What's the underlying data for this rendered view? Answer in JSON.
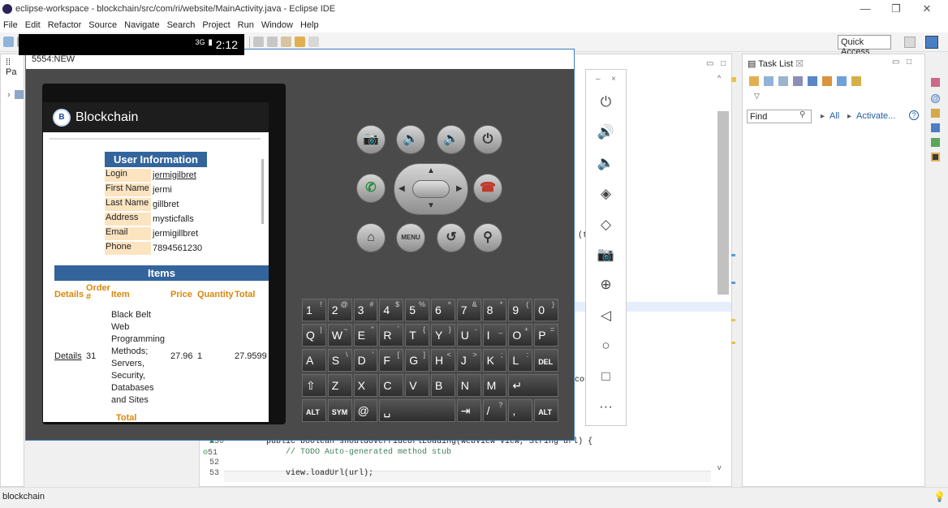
{
  "window": {
    "title": "eclipse-workspace - blockchain/src/com/ri/website/MainActivity.java - Eclipse IDE"
  },
  "menu": [
    "File",
    "Edit",
    "Refactor",
    "Source",
    "Navigate",
    "Search",
    "Project",
    "Run",
    "Window",
    "Help"
  ],
  "toolbar": {
    "quick_access": "Quick Access"
  },
  "left_panel": {
    "tab": "Pa"
  },
  "task_list": {
    "tab": "Task List",
    "find": "Find",
    "all": "All",
    "activate": "Activate..."
  },
  "editor": {
    "lines": [
      {
        "num": "50",
        "code": "public boolean shouldOverrideUrlLoading(WebView view, String url) {"
      },
      {
        "num": "51",
        "code": "// TODO Auto-generated method stub"
      },
      {
        "num": "52",
        "code": ""
      },
      {
        "num": "53",
        "code": "view.loadUrl(url);"
      }
    ],
    "fragment_t": "(t",
    "fragment_con": "con"
  },
  "emulator": {
    "title": "5554:NEW",
    "status_time": "2:12",
    "status_signal": "3G",
    "app_logo": "B",
    "app_name": "Blockchain",
    "user_info": {
      "header": "User Information",
      "rows": [
        {
          "label": "Login",
          "value": "jermigilbret"
        },
        {
          "label": "First Name",
          "value": "jermi"
        },
        {
          "label": "Last Name",
          "value": "gillbret"
        },
        {
          "label": "Address",
          "value": "mysticfalls"
        },
        {
          "label": "Email",
          "value": "jermigillbret"
        },
        {
          "label": "Phone",
          "value": "7894561230"
        }
      ]
    },
    "items": {
      "header": "Items",
      "columns": {
        "details": "Details",
        "order": "Order #",
        "item": "Item",
        "price": "Price",
        "quantity": "Quantity",
        "total": "Total"
      },
      "row": {
        "details": "Details",
        "order": "31",
        "item": "Black Belt Web Programming Methods; Servers, Security, Databases and Sites",
        "price": "27.96",
        "quantity": "1",
        "total": "27.9599"
      },
      "footer": "Total"
    },
    "hw_buttons": {
      "menu": "MENU"
    },
    "keyboard": {
      "row1": [
        [
          "1",
          "!"
        ],
        [
          "2",
          "@"
        ],
        [
          "3",
          "#"
        ],
        [
          "4",
          "$"
        ],
        [
          "5",
          "%"
        ],
        [
          "6",
          "^"
        ],
        [
          "7",
          "&"
        ],
        [
          "8",
          "*"
        ],
        [
          "9",
          "("
        ],
        [
          "0",
          ")"
        ]
      ],
      "row2": [
        [
          "Q",
          "|"
        ],
        [
          "W",
          "~"
        ],
        [
          "E",
          "\""
        ],
        [
          "R",
          "`"
        ],
        [
          "T",
          "{"
        ],
        [
          "Y",
          "}"
        ],
        [
          "U",
          "-"
        ],
        [
          "I",
          "_"
        ],
        [
          "O",
          "+"
        ],
        [
          "P",
          "="
        ]
      ],
      "row3": [
        [
          "A",
          ""
        ],
        [
          "S",
          "\\"
        ],
        [
          "D",
          "'"
        ],
        [
          "F",
          "["
        ],
        [
          "G",
          "]"
        ],
        [
          "H",
          "<"
        ],
        [
          "J",
          ">"
        ],
        [
          "K",
          ";"
        ],
        [
          "L",
          ":"
        ],
        [
          "DEL",
          ""
        ]
      ],
      "row4": [
        [
          "⇧",
          ""
        ],
        [
          "Z",
          ""
        ],
        [
          "X",
          ""
        ],
        [
          "C",
          ""
        ],
        [
          "V",
          ""
        ],
        [
          "B",
          ""
        ],
        [
          "N",
          ""
        ],
        [
          "M",
          ""
        ],
        [
          "↵",
          ""
        ]
      ],
      "row5": [
        [
          "ALT",
          ""
        ],
        [
          "SYM",
          ""
        ],
        [
          "@",
          ""
        ],
        [
          "␣",
          ""
        ],
        [
          "⇥",
          ""
        ],
        [
          "/",
          "?"
        ],
        [
          ",",
          ""
        ],
        [
          "ALT",
          ""
        ]
      ]
    }
  },
  "status_bar": {
    "text": "blockchain"
  }
}
